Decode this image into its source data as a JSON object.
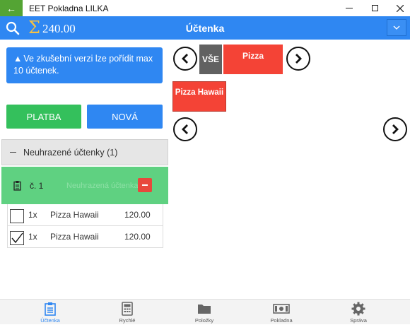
{
  "window": {
    "title": "EET Pokladna LILKA",
    "back_icon": "back-arrow-icon",
    "controls": [
      "minimize-icon",
      "maximize-icon",
      "close-icon"
    ]
  },
  "appbar": {
    "total": "240.00",
    "page_title": "Účtenka",
    "accent": "#2f87f2"
  },
  "info_message": "Ve zkušební verzi lze pořídit max 10 účtenek.",
  "buttons": {
    "pay": "PLATBA",
    "new": "NOVÁ",
    "pay_color": "#34c05c"
  },
  "receipts_section": {
    "title": "Neuhrazené účtenky (1)"
  },
  "receipt": {
    "number": "č. 1",
    "ghost_text": "Neuhrazená účtenka",
    "color": "#5fd181"
  },
  "items": [
    {
      "qty": "1x",
      "name": "Pizza Hawaii",
      "price": "120.00",
      "checked": false
    },
    {
      "qty": "1x",
      "name": "Pizza Hawaii",
      "price": "120.00",
      "checked": true
    }
  ],
  "categories": {
    "all": "VŠE",
    "pizza": "Pizza",
    "color_all": "#616161",
    "color_pizza": "#f44336"
  },
  "products": [
    {
      "name": "Pizza Hawaii"
    }
  ],
  "nav": [
    {
      "label": "Účtenka",
      "icon": "clipboard-icon",
      "active": true
    },
    {
      "label": "Rychlé",
      "icon": "calculator-icon",
      "active": false
    },
    {
      "label": "Položky",
      "icon": "folder-icon",
      "active": false
    },
    {
      "label": "Pokladna",
      "icon": "cash-icon",
      "active": false
    },
    {
      "label": "Správa",
      "icon": "gear-icon",
      "active": false
    }
  ]
}
